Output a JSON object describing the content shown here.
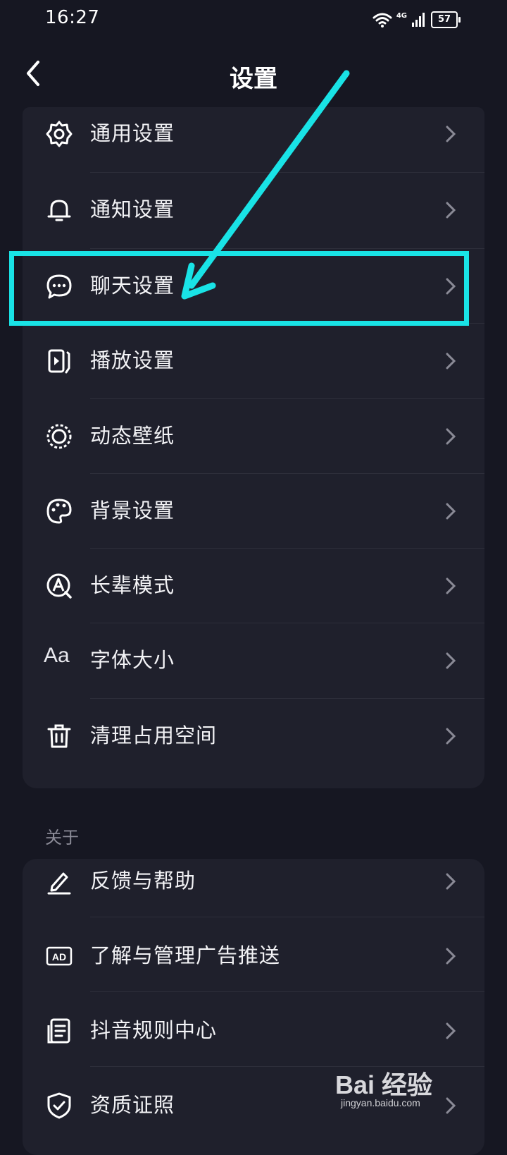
{
  "status_bar": {
    "time": "16:27",
    "network": "4G",
    "battery": "57"
  },
  "header": {
    "title": "设置",
    "back_icon": "chevron-left-icon"
  },
  "settings_group": {
    "items": [
      {
        "label": "通用设置",
        "icon": "gear-icon"
      },
      {
        "label": "通知设置",
        "icon": "bell-icon"
      },
      {
        "label": "聊天设置",
        "icon": "chat-bubble-icon"
      },
      {
        "label": "播放设置",
        "icon": "play-screen-icon"
      },
      {
        "label": "动态壁纸",
        "icon": "live-wallpaper-icon"
      },
      {
        "label": "背景设置",
        "icon": "palette-icon"
      },
      {
        "label": "长辈模式",
        "icon": "elder-mode-icon"
      },
      {
        "label": "字体大小",
        "icon": "font-size-icon",
        "icon_text": "Aa"
      },
      {
        "label": "清理占用空间",
        "icon": "trash-icon"
      }
    ]
  },
  "about_section": {
    "title": "关于",
    "items": [
      {
        "label": "反馈与帮助",
        "icon": "pen-icon"
      },
      {
        "label": "了解与管理广告推送",
        "icon": "ad-icon",
        "icon_text": "AD"
      },
      {
        "label": "抖音规则中心",
        "icon": "document-icon"
      },
      {
        "label": "资质证照",
        "icon": "shield-check-icon"
      }
    ]
  },
  "annotation": {
    "highlight_color": "#19e3e6",
    "target": "聊天设置"
  },
  "watermark": {
    "brand": "Bai 经验",
    "url": "jingyan.baidu.com"
  }
}
